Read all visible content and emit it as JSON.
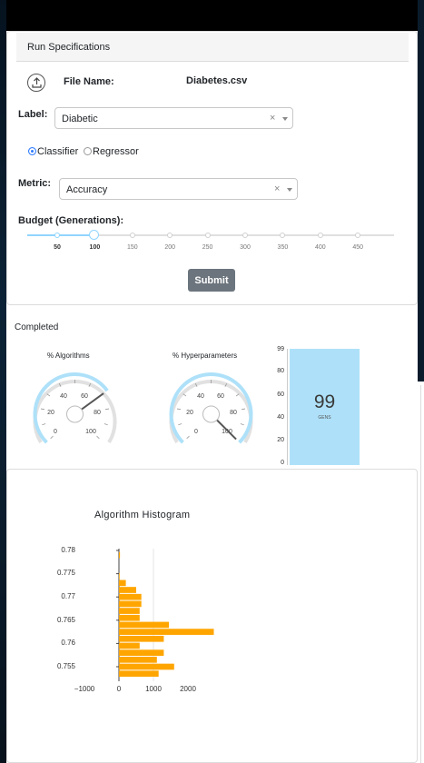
{
  "run_spec": {
    "header": "Run Specifications",
    "file_label": "File Name:",
    "file_name": "Diabetes.csv",
    "upload_icon": "upload-icon",
    "label_label": "Label:",
    "label_value": "Diabetic",
    "radio": {
      "classifier": "Classifier",
      "regressor": "Regressor",
      "selected": "Classifier"
    },
    "metric_label": "Metric:",
    "metric_value": "Accuracy",
    "clear_glyph": "×",
    "budget_label": "Budget (Generations):",
    "budget_marks": [
      "50",
      "100",
      "150",
      "200",
      "250",
      "300",
      "350",
      "400",
      "450"
    ],
    "budget_value": 100,
    "submit_label": "Submit"
  },
  "status": "Completed",
  "gauges": {
    "algorithms": {
      "title": "% Algorithms",
      "labels": {
        "l0": "0",
        "l20": "20",
        "l40": "40",
        "l60": "60",
        "l80": "80",
        "l100": "100"
      },
      "value": 70
    },
    "hyperparameters": {
      "title": "% Hyperparameters",
      "labels": {
        "l0": "0",
        "l20": "20",
        "l40": "40",
        "l60": "60",
        "l80": "80",
        "l100": "100"
      },
      "value": 100
    }
  },
  "gens": {
    "value": "99",
    "label": "GENS",
    "ticks": [
      "99",
      "80",
      "60",
      "40",
      "20",
      "0"
    ],
    "color": "#aee1f9"
  },
  "histogram": {
    "title": "Algorithm Histogram",
    "color": "#ffa500"
  },
  "chart_data": {
    "type": "bar",
    "orientation": "horizontal",
    "title": "Algorithm Histogram",
    "y": [
      0.7535,
      0.755,
      0.7565,
      0.758,
      0.7595,
      0.761,
      0.7625,
      0.764,
      0.7655,
      0.767,
      0.7685,
      0.77,
      0.7715,
      0.773,
      0.7745,
      0.776,
      0.7775,
      0.779
    ],
    "values": [
      1150,
      1600,
      1100,
      1300,
      600,
      1300,
      2750,
      1450,
      600,
      600,
      650,
      650,
      500,
      200,
      20,
      0,
      0,
      30
    ],
    "yticks": [
      "0.78",
      "0.775",
      "0.77",
      "0.765",
      "0.76",
      "0.755"
    ],
    "xticks": [
      "−1000",
      "0",
      "1000",
      "2000"
    ],
    "ylim": [
      0.752,
      0.7805
    ],
    "xlim": [
      -1000,
      2800
    ]
  }
}
